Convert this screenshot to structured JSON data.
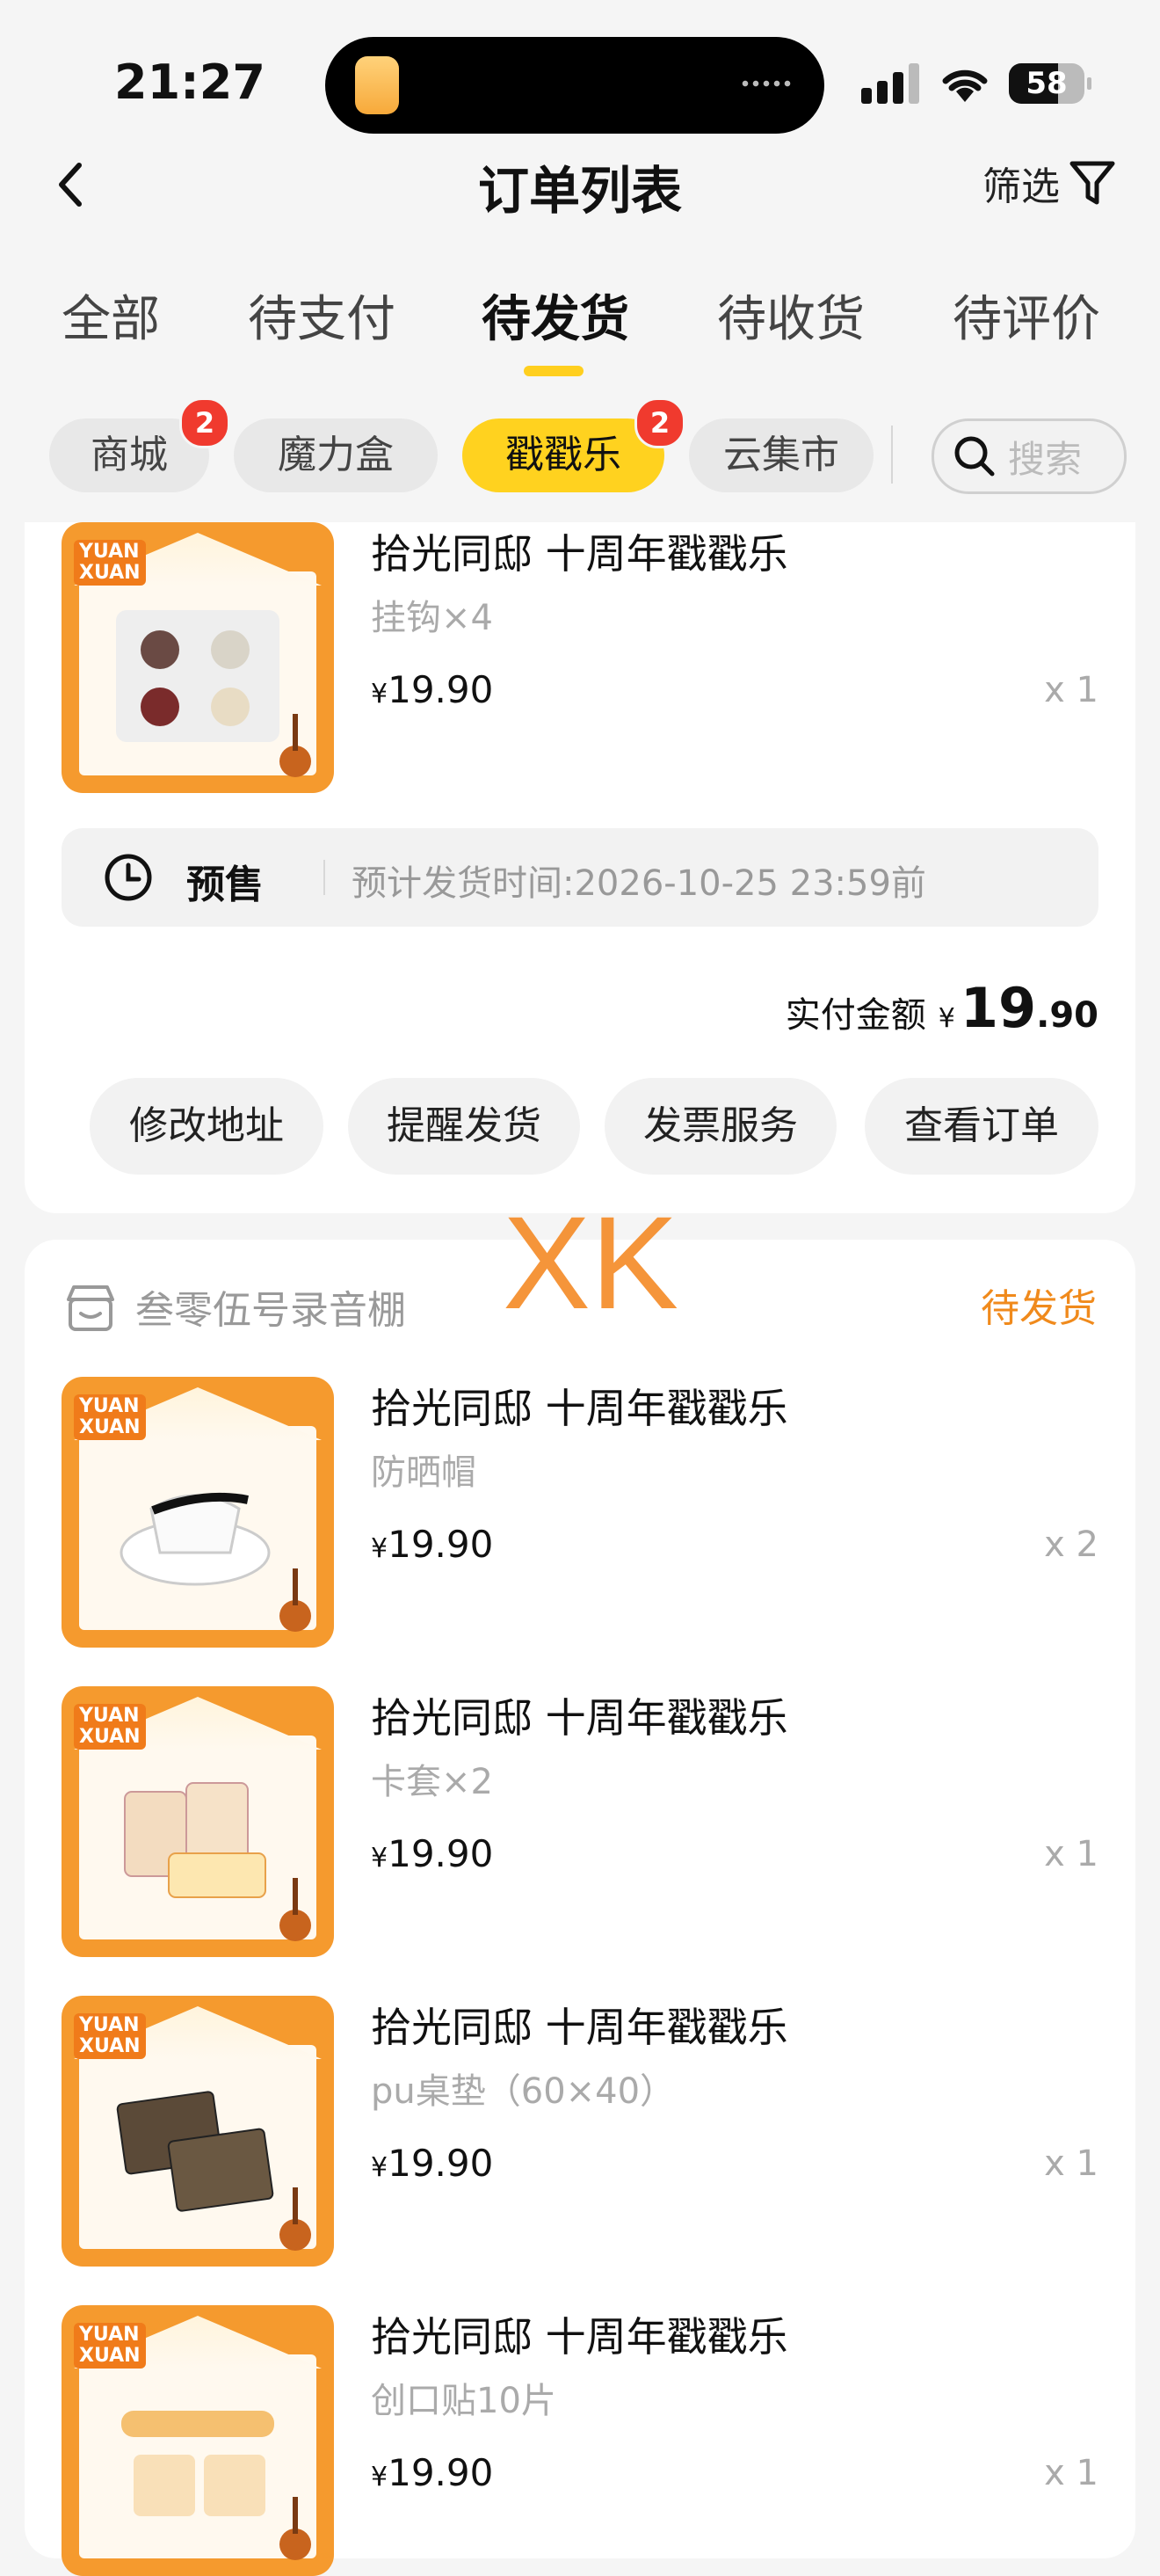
{
  "status_bar": {
    "time": "21:27",
    "battery": "58"
  },
  "header": {
    "title": "订单列表",
    "filter_label": "筛选"
  },
  "tabs": [
    {
      "label": "全部",
      "active": false
    },
    {
      "label": "待支付",
      "active": false
    },
    {
      "label": "待发货",
      "active": true
    },
    {
      "label": "待收货",
      "active": false
    },
    {
      "label": "待评价",
      "active": false
    }
  ],
  "chips": [
    {
      "label": "商城",
      "badge": "2"
    },
    {
      "label": "魔力盒",
      "badge": ""
    },
    {
      "label": "戳戳乐",
      "badge": "2",
      "active": true
    },
    {
      "label": "云集市",
      "badge": ""
    }
  ],
  "search": {
    "placeholder": "搜索"
  },
  "order1": {
    "items": [
      {
        "name": "拾光同邸 十周年戳戳乐",
        "spec": "挂钩×4",
        "currency": "¥",
        "price": "19.90",
        "qty": "x 1"
      }
    ],
    "presale": {
      "label": "预售",
      "text": "预计发货时间:2026-10-25 23:59前"
    },
    "paid": {
      "label": "实付金额",
      "currency": "¥",
      "int": "19",
      "dec": ".90"
    },
    "buttons": [
      "修改地址",
      "提醒发货",
      "发票服务",
      "查看订单"
    ]
  },
  "order2": {
    "shop": "叁零伍号录音棚",
    "status": "待发货",
    "items": [
      {
        "name": "拾光同邸 十周年戳戳乐",
        "spec": "防晒帽",
        "currency": "¥",
        "price": "19.90",
        "qty": "x 2"
      },
      {
        "name": "拾光同邸 十周年戳戳乐",
        "spec": "卡套×2",
        "currency": "¥",
        "price": "19.90",
        "qty": "x 1"
      },
      {
        "name": "拾光同邸 十周年戳戳乐",
        "spec": "pu桌垫（60×40）",
        "currency": "¥",
        "price": "19.90",
        "qty": "x 1"
      },
      {
        "name": "拾光同邸 十周年戳戳乐",
        "spec": "创口贴10片",
        "currency": "¥",
        "price": "19.90",
        "qty": "x 1"
      }
    ]
  },
  "watermark": "XK",
  "colors": {
    "accent_yellow": "#ffd21f",
    "badge_red": "#f03a2e",
    "status_orange": "#f08a1c"
  }
}
